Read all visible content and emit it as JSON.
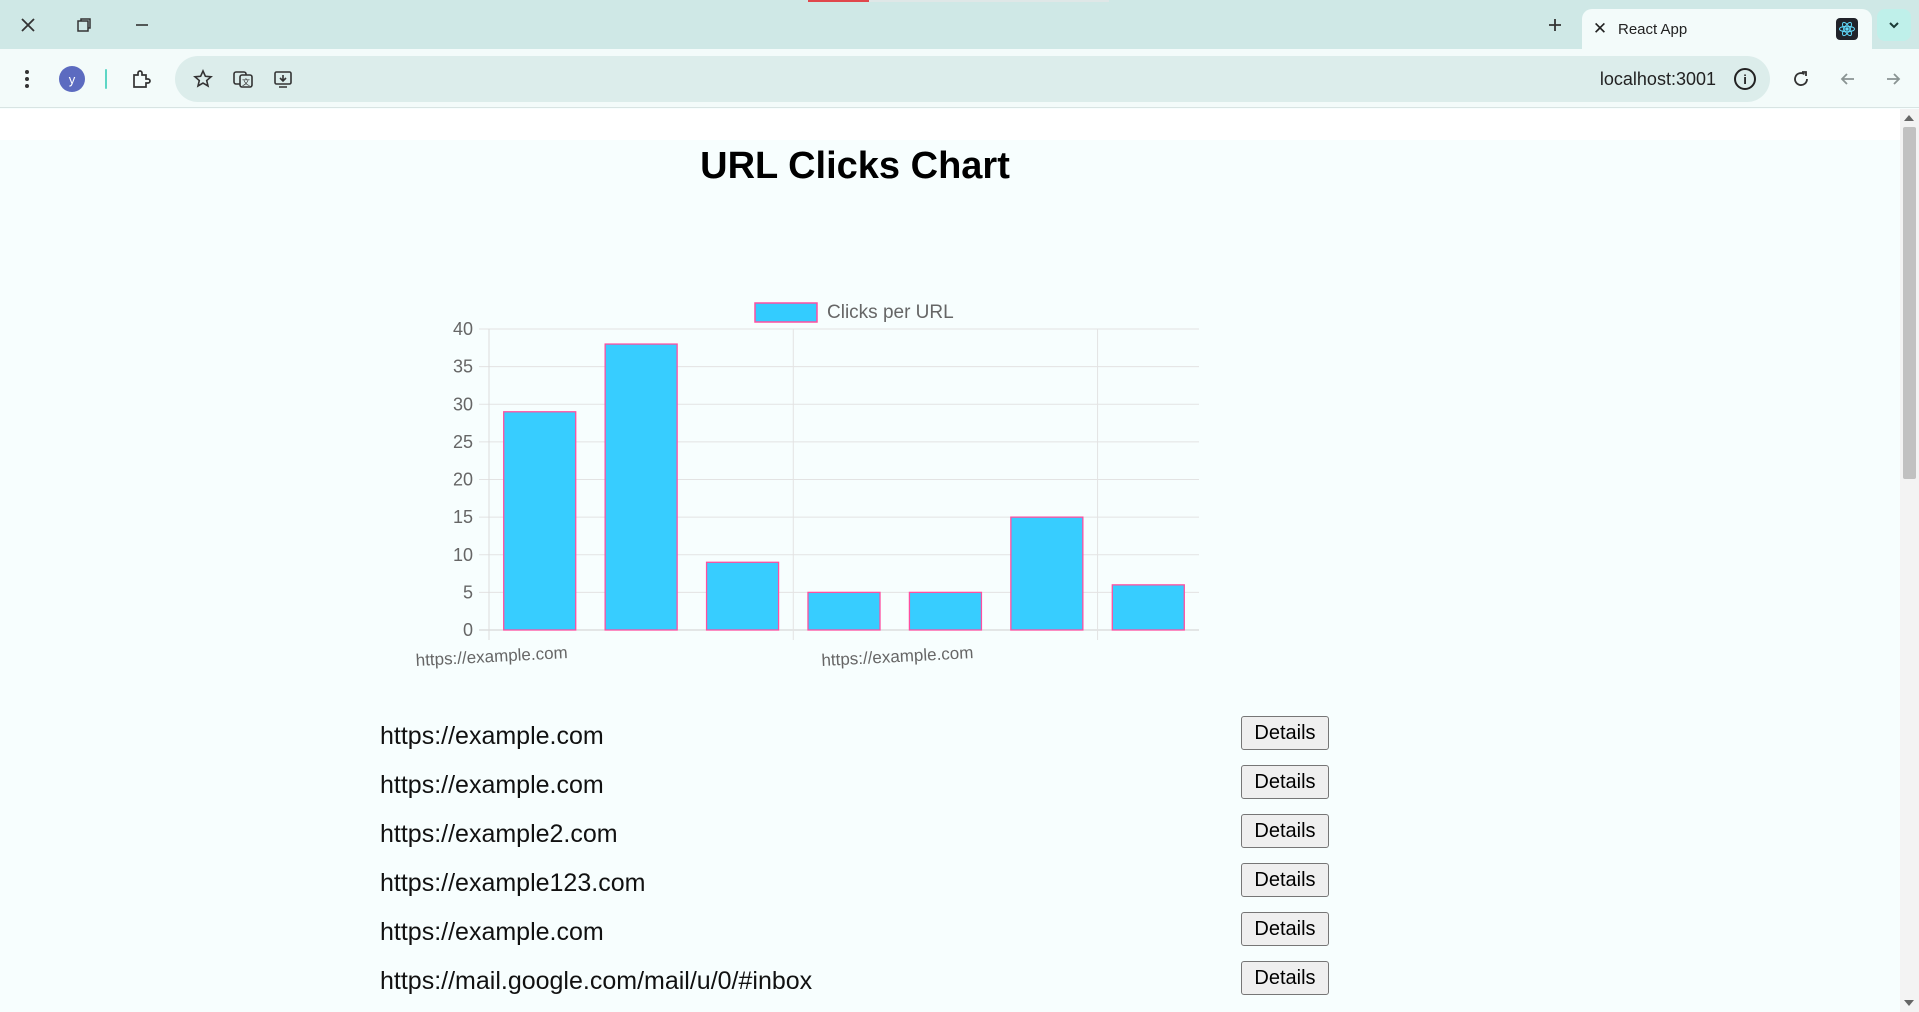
{
  "browser": {
    "tab_title": "React App",
    "profile_initial": "y",
    "address": "localhost:3001",
    "accent_color": "#5dd6c5"
  },
  "page": {
    "title": "URL Clicks Chart"
  },
  "chart_data": {
    "type": "bar",
    "title": "",
    "legend": "Clicks per URL",
    "legend_position": "top",
    "categories": [
      "https://example.com",
      "https://example.com",
      "https://example2.com",
      "https://example123.com",
      "https://example.com",
      "https://mail.google.com/mail/u/0/#inbox",
      "https://mail.google.com/mail/u/0/#inbox"
    ],
    "visible_x_tick_labels": [
      "https://example.com",
      "https://example.com"
    ],
    "series": [
      {
        "name": "Clicks per URL",
        "values": [
          29,
          38,
          9,
          5,
          5,
          15,
          6
        ]
      }
    ],
    "ylim": [
      0,
      40
    ],
    "y_ticks": [
      0,
      5,
      10,
      15,
      20,
      25,
      30,
      35,
      40
    ],
    "grid": true,
    "bar_color": "#33ccff",
    "bar_border_color": "#ff4fa0"
  },
  "url_list": {
    "button_label": "Details",
    "items": [
      "https://example.com",
      "https://example.com",
      "https://example2.com",
      "https://example123.com",
      "https://example.com",
      "https://mail.google.com/mail/u/0/#inbox"
    ]
  }
}
